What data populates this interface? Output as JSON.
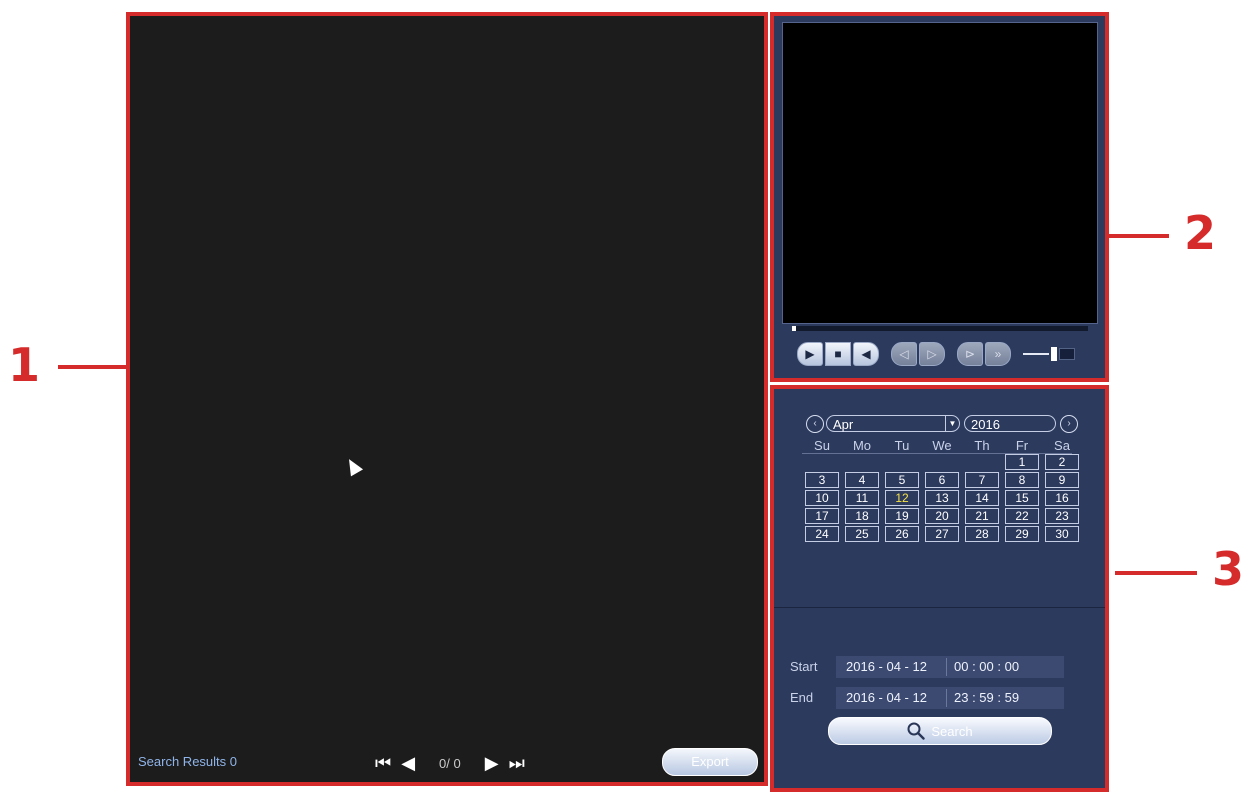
{
  "callouts": [
    "1",
    "2",
    "3"
  ],
  "results": {
    "label": "Search Results",
    "count": "0",
    "page": "0/ 0",
    "icons": [
      "first-page-icon",
      "prev-page-icon",
      "next-page-icon",
      "last-page-icon"
    ],
    "export_label": "Export"
  },
  "preview": {
    "progress": 0,
    "controls": [
      {
        "name": "play",
        "glyph": "▶",
        "enabled": true
      },
      {
        "name": "stop",
        "glyph": "■",
        "enabled": true
      },
      {
        "name": "reverse",
        "glyph": "◀",
        "enabled": true
      },
      {
        "name": "slow-reverse",
        "glyph": "◁",
        "enabled": false
      },
      {
        "name": "slow-forward",
        "glyph": "▷",
        "enabled": false
      },
      {
        "name": "step-forward",
        "glyph": "⊳",
        "enabled": false
      },
      {
        "name": "fast-forward",
        "glyph": "»",
        "enabled": false
      }
    ]
  },
  "calendar": {
    "prev_icon": "‹",
    "next_icon": "›",
    "month": "Apr",
    "year": "2016",
    "weekdays": [
      "Su",
      "Mo",
      "Tu",
      "We",
      "Th",
      "Fr",
      "Sa"
    ],
    "today": "12",
    "weeks": [
      [
        "",
        "",
        "",
        "",
        "",
        "1",
        "2"
      ],
      [
        "3",
        "4",
        "5",
        "6",
        "7",
        "8",
        "9"
      ],
      [
        "10",
        "11",
        "12",
        "13",
        "14",
        "15",
        "16"
      ],
      [
        "17",
        "18",
        "19",
        "20",
        "21",
        "22",
        "23"
      ],
      [
        "24",
        "25",
        "26",
        "27",
        "28",
        "29",
        "30"
      ]
    ]
  },
  "time_range": {
    "start_label": "Start",
    "start_date": "2016 - 04 - 12",
    "start_time": "00 : 00 : 00",
    "end_label": "End",
    "end_date": "2016 - 04 - 12",
    "end_time": "23 : 59 : 59",
    "search_label": "Search"
  },
  "colors": {
    "annotation": "#d52b2b",
    "panel": "#2c3a5e",
    "today": "#f5e145"
  }
}
